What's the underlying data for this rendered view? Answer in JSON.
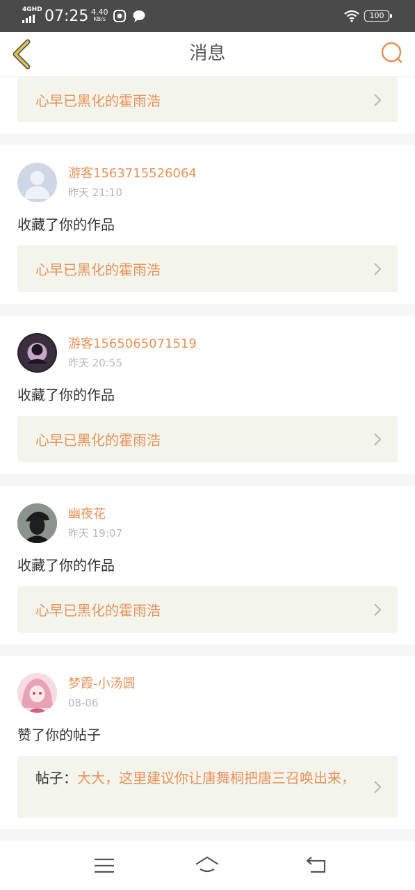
{
  "status_bar": {
    "network": "4GHD",
    "time": "07:25",
    "speed_value": "4.40",
    "speed_unit": "KB/s",
    "battery": "100"
  },
  "header": {
    "title": "消息",
    "back_icon": "chevron-left-icon",
    "search_icon": "search-icon"
  },
  "colors": {
    "accent": "#e99158",
    "link_bg": "#f3f4ec",
    "back_icon": "#d8b23a"
  },
  "top_partial": {
    "target": "心早已黑化的霍雨浩"
  },
  "messages": [
    {
      "user": "游客1563715526064",
      "time": "昨天 21:10",
      "action": "收藏了你的作品",
      "target": "心早已黑化的霍雨浩"
    },
    {
      "user": "游客1565065071519",
      "time": "昨天 20:55",
      "action": "收藏了你的作品",
      "target": "心早已黑化的霍雨浩"
    },
    {
      "user": "幽夜花",
      "time": "昨天 19:07",
      "action": "收藏了你的作品",
      "target": "心早已黑化的霍雨浩"
    },
    {
      "user": "梦霞-小汤圆",
      "time": "08-06",
      "action": "赞了你的帖子",
      "target_label": "帖子：",
      "target": "大大，这里建议你让唐舞桐把唐三召唤出来，"
    }
  ],
  "nav_bar": {
    "menu_icon": "menu-icon",
    "home_icon": "home-icon",
    "back_icon": "back-icon"
  }
}
